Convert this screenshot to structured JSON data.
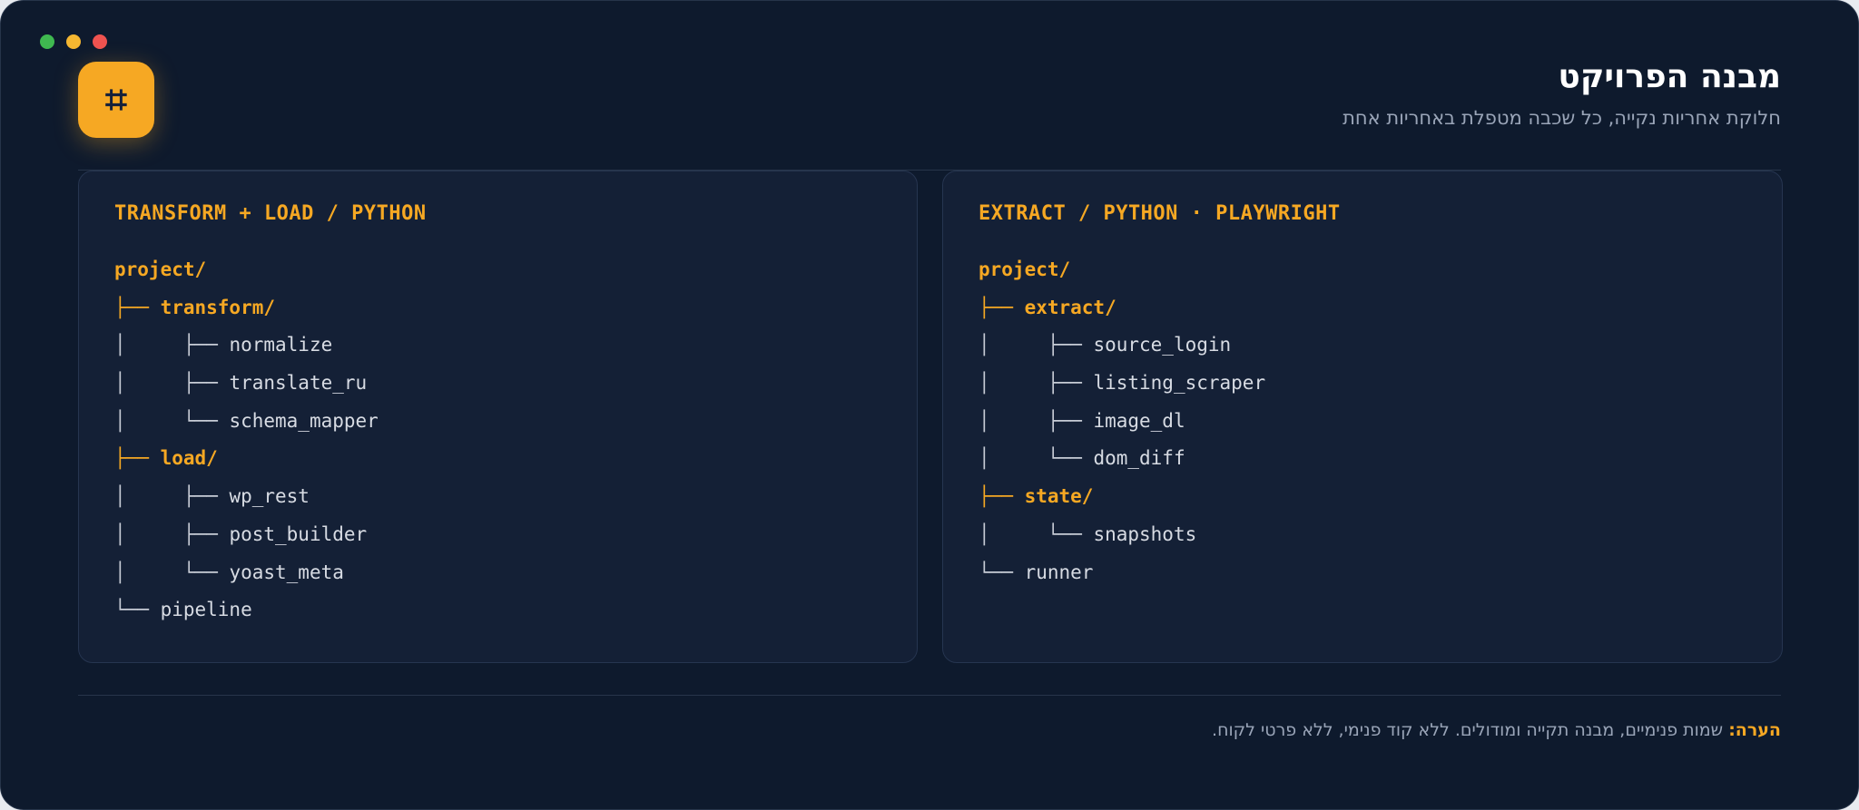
{
  "window": {
    "title": "מבנה הפרויקט",
    "subtitle": "חלוקת אחריות נקייה, כל שכבה מטפלת באחריות אחת",
    "app_icon_glyph": "⌗",
    "controls": [
      {
        "name": "maximize",
        "color": "#3fb950"
      },
      {
        "name": "minimize",
        "color": "#f5b731"
      },
      {
        "name": "close",
        "color": "#ef5350"
      }
    ],
    "colors": {
      "background": "#0e1a2d",
      "panel": "#142036",
      "accent": "#f6a823",
      "text": "#d7dbe3",
      "muted": "#9aa5b8"
    }
  },
  "panels": {
    "left": {
      "heading": "TRANSFORM + LOAD / PYTHON",
      "lines": [
        {
          "prefix": "",
          "name": "project/",
          "dir": true,
          "accent_prefix": false
        },
        {
          "prefix": "├── ",
          "name": "transform/",
          "dir": true,
          "accent_prefix": true
        },
        {
          "prefix": "│     ├── ",
          "name": "normalize",
          "dir": false,
          "accent_prefix": false
        },
        {
          "prefix": "│     ├── ",
          "name": "translate_ru",
          "dir": false,
          "accent_prefix": false
        },
        {
          "prefix": "│     └── ",
          "name": "schema_mapper",
          "dir": false,
          "accent_prefix": false
        },
        {
          "prefix": "├── ",
          "name": "load/",
          "dir": true,
          "accent_prefix": true
        },
        {
          "prefix": "│     ├── ",
          "name": "wp_rest",
          "dir": false,
          "accent_prefix": false
        },
        {
          "prefix": "│     ├── ",
          "name": "post_builder",
          "dir": false,
          "accent_prefix": false
        },
        {
          "prefix": "│     └── ",
          "name": "yoast_meta",
          "dir": false,
          "accent_prefix": false
        },
        {
          "prefix": "└── ",
          "name": "pipeline",
          "dir": false,
          "accent_prefix": false
        }
      ]
    },
    "right": {
      "heading": "EXTRACT / PYTHON · PLAYWRIGHT",
      "lines": [
        {
          "prefix": "",
          "name": "project/",
          "dir": true,
          "accent_prefix": false
        },
        {
          "prefix": "├── ",
          "name": "extract/",
          "dir": true,
          "accent_prefix": true
        },
        {
          "prefix": "│     ├── ",
          "name": "source_login",
          "dir": false,
          "accent_prefix": false
        },
        {
          "prefix": "│     ├── ",
          "name": "listing_scraper",
          "dir": false,
          "accent_prefix": false
        },
        {
          "prefix": "│     ├── ",
          "name": "image_dl",
          "dir": false,
          "accent_prefix": false
        },
        {
          "prefix": "│     └── ",
          "name": "dom_diff",
          "dir": false,
          "accent_prefix": false
        },
        {
          "prefix": "├── ",
          "name": "state/",
          "dir": true,
          "accent_prefix": true
        },
        {
          "prefix": "│     └── ",
          "name": "snapshots",
          "dir": false,
          "accent_prefix": false
        },
        {
          "prefix": "└── ",
          "name": "runner",
          "dir": false,
          "accent_prefix": false
        }
      ]
    }
  },
  "footer": {
    "note_label": "הערה:",
    "note_text": " שמות פנימיים, מבנה תקייה ומודולים. ללא קוד פנימי, ללא פרטי לקוח."
  }
}
